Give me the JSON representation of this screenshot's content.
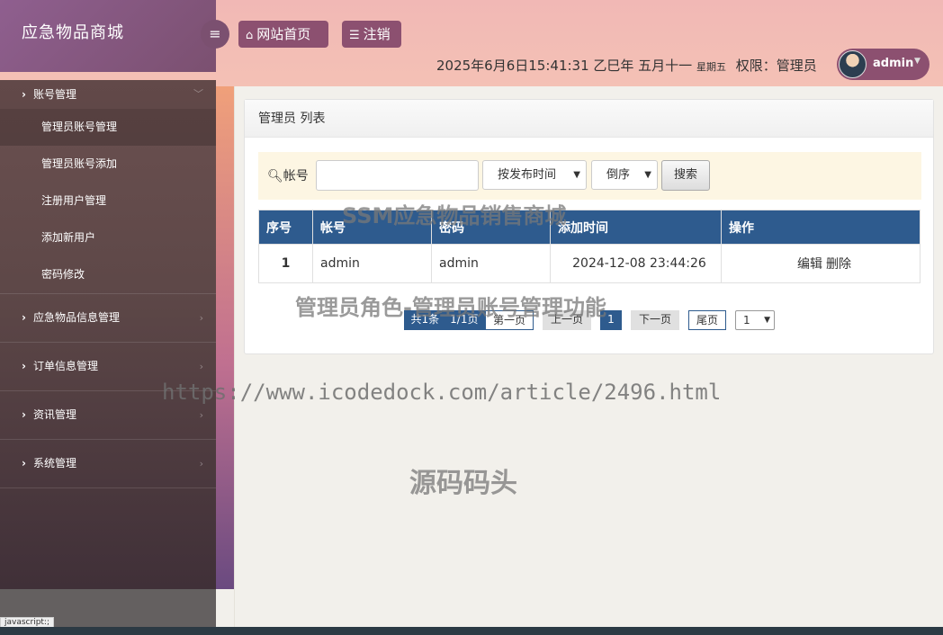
{
  "brand": {
    "title": "应急物品商城"
  },
  "header": {
    "home_icon": "home-icon",
    "home_label": "网站首页",
    "logout_icon": "list-icon",
    "logout_label": "注销",
    "datetime": "2025年6月6日15:41:31 乙巳年 五月十一",
    "weekday": "星期五",
    "role_text": "权限：管理员",
    "username": "admin"
  },
  "sidebar": {
    "groups": [
      {
        "label": "账号管理",
        "items": [
          "管理员账号管理",
          "管理员账号添加",
          "注册用户管理",
          "添加新用户",
          "密码修改"
        ]
      },
      {
        "label": "应急物品信息管理"
      },
      {
        "label": "订单信息管理"
      },
      {
        "label": "资讯管理"
      },
      {
        "label": "系统管理"
      }
    ],
    "status_tip": "javascript:;"
  },
  "panel": {
    "title": "管理员 列表"
  },
  "search": {
    "label": "帐号",
    "input_value": "",
    "sort_field": "按发布时间",
    "sort_order": "倒序",
    "button": "搜索"
  },
  "table": {
    "headers": [
      "序号",
      "帐号",
      "密码",
      "添加时间",
      "操作"
    ],
    "rows": [
      {
        "index": "1",
        "account": "admin",
        "password": "admin",
        "created": "2024-12-08 23:44:26",
        "edit": "编辑",
        "delete": "删除"
      }
    ]
  },
  "pager": {
    "total": "共1条　1/1页",
    "first": "第一页",
    "prev": "上一页",
    "current": "1",
    "next": "下一页",
    "last": "尾页",
    "jump_value": "1"
  },
  "watermarks": {
    "line1": "SSM应急物品销售商城",
    "line2": "管理员角色-管理员账号管理功能",
    "line3": "https://www.icodedock.com/article/2496.html",
    "line4": "源码码头"
  },
  "colors": {
    "header_bg": "#f1b8b5",
    "brand_purple": "#8c5070",
    "table_header": "#2e5b8e",
    "search_bar_bg": "#fdf6e3"
  }
}
